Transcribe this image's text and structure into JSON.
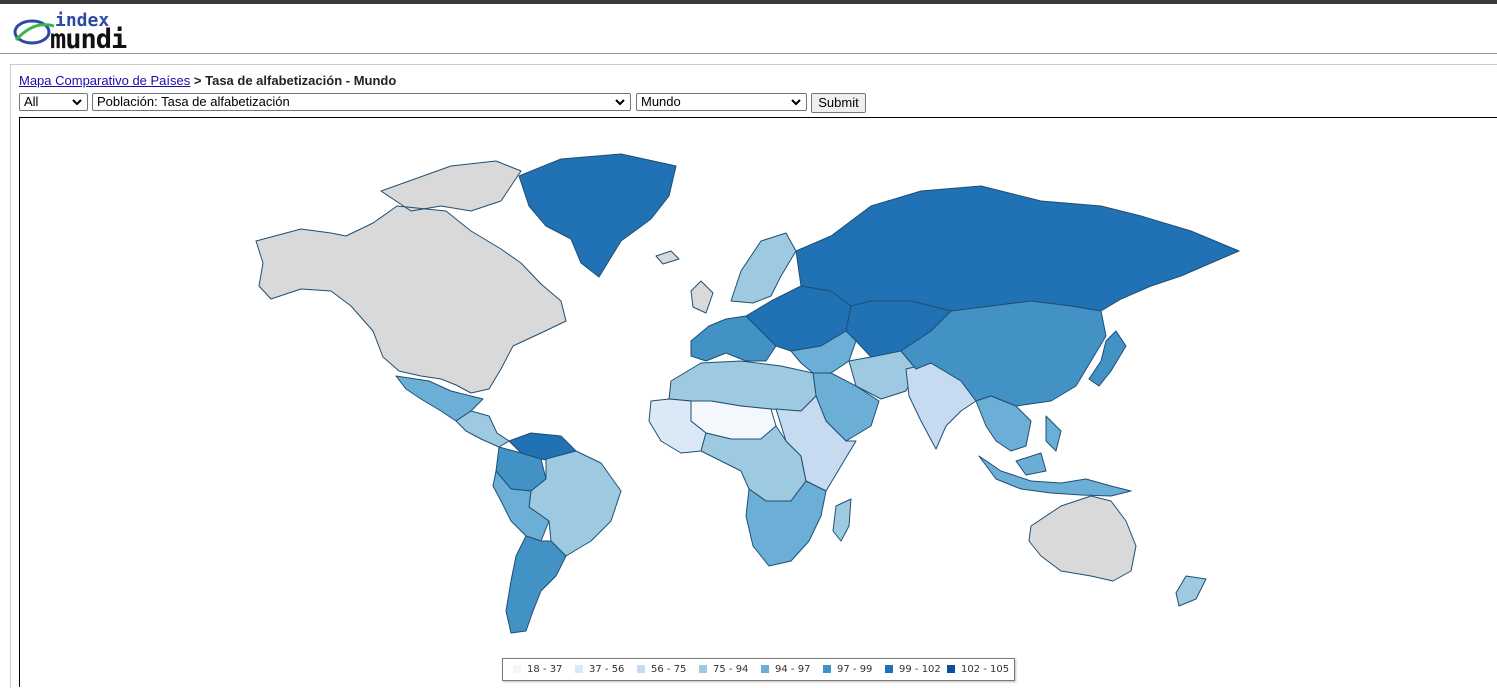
{
  "logo": {
    "line1": "index",
    "line2": "mundi"
  },
  "breadcrumb": {
    "link_label": "Mapa Comparativo de Países",
    "separator": ">",
    "current": "Tasa de alfabetización - Mundo"
  },
  "controls": {
    "category_select": "All",
    "indicator_select": "Población: Tasa de alfabetización",
    "region_select": "Mundo",
    "submit_label": "Submit"
  },
  "map": {
    "no_data_color": "#d9d9d9",
    "border_color": "#1f4f73",
    "regions": [
      {
        "name": "North America",
        "bin": -1
      },
      {
        "name": "Greenland",
        "bin": 6
      },
      {
        "name": "Mexico",
        "bin": 4
      },
      {
        "name": "Central America",
        "bin": 3
      },
      {
        "name": "Venezuela",
        "bin": 6
      },
      {
        "name": "Colombia",
        "bin": 5
      },
      {
        "name": "Brazil",
        "bin": 3
      },
      {
        "name": "Peru-Bolivia",
        "bin": 4
      },
      {
        "name": "Argentina-Chile",
        "bin": 5
      },
      {
        "name": "Western Europe",
        "bin": 5
      },
      {
        "name": "Scandinavia",
        "bin": 3
      },
      {
        "name": "Eastern Europe",
        "bin": 6
      },
      {
        "name": "Russia",
        "bin": 6
      },
      {
        "name": "Central Asia",
        "bin": 6
      },
      {
        "name": "Middle East",
        "bin": 4
      },
      {
        "name": "Arabia",
        "bin": 4
      },
      {
        "name": "Iran-Afghanistan",
        "bin": 3
      },
      {
        "name": "South Asia",
        "bin": 2
      },
      {
        "name": "China-Mongolia",
        "bin": 5
      },
      {
        "name": "Southeast Asia",
        "bin": 4
      },
      {
        "name": "Indonesia",
        "bin": 4
      },
      {
        "name": "Japan",
        "bin": 5
      },
      {
        "name": "North Africa",
        "bin": 3
      },
      {
        "name": "Sahel",
        "bin": 0
      },
      {
        "name": "West Africa",
        "bin": 1
      },
      {
        "name": "Central Africa",
        "bin": 3
      },
      {
        "name": "East Africa",
        "bin": 2
      },
      {
        "name": "Southern Africa",
        "bin": 4
      },
      {
        "name": "Madagascar",
        "bin": 3
      },
      {
        "name": "Australia",
        "bin": -1
      },
      {
        "name": "New Zealand",
        "bin": 3
      },
      {
        "name": "UK-Iceland",
        "bin": -1
      }
    ]
  },
  "legend": {
    "items": [
      {
        "label": "18 - 37",
        "color": "#f4f8fc"
      },
      {
        "label": "37 - 56",
        "color": "#dbe9f6"
      },
      {
        "label": "56 - 75",
        "color": "#c6dbef"
      },
      {
        "label": "75 - 94",
        "color": "#9ecae1"
      },
      {
        "label": "94 - 97",
        "color": "#6baed6"
      },
      {
        "label": "97 - 99",
        "color": "#4292c6"
      },
      {
        "label": "99 - 102",
        "color": "#2171b5"
      },
      {
        "label": "102 - 105",
        "color": "#08519c"
      }
    ]
  }
}
